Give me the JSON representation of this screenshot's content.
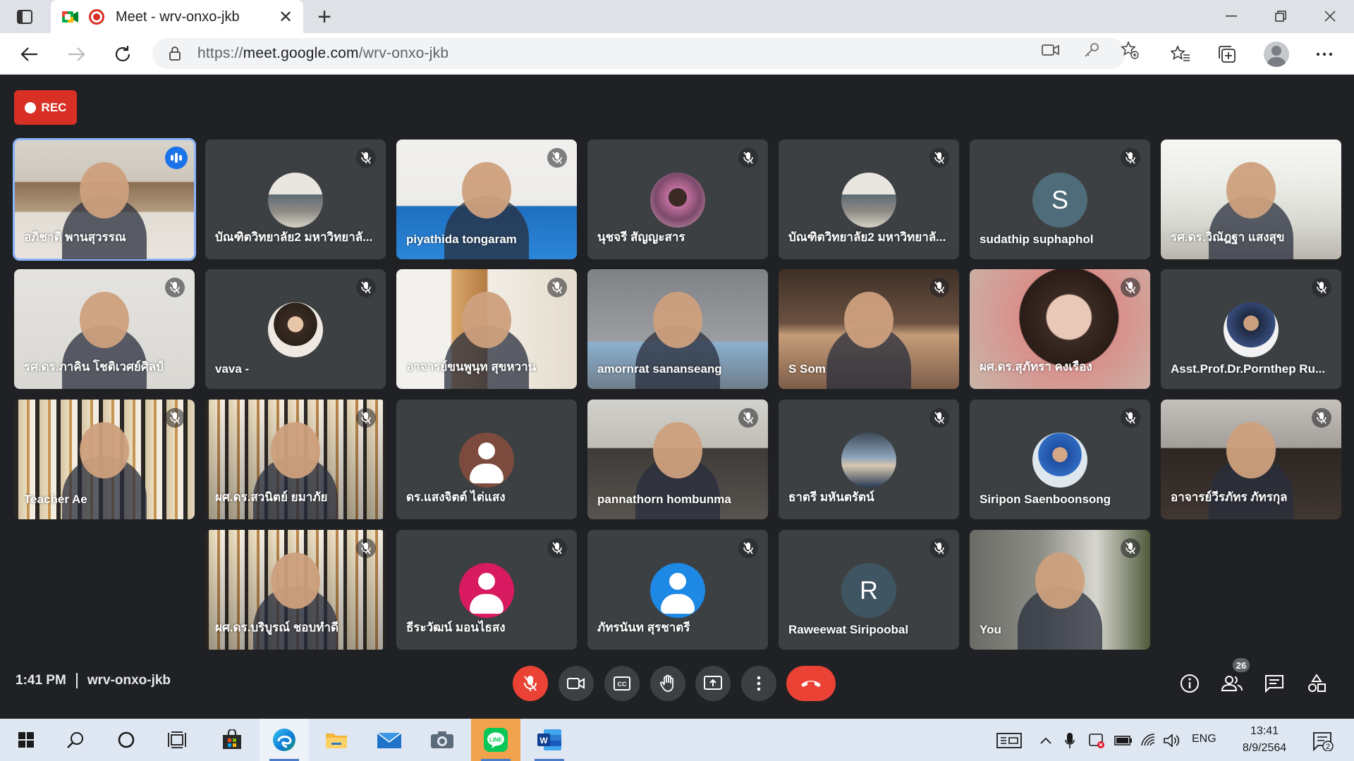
{
  "browser": {
    "tab_title": "Meet - wrv-onxo-jkb",
    "url_prefix": "https://",
    "url_host": "meet.google.com",
    "url_path": "/wrv-onxo-jkb"
  },
  "meet": {
    "rec_label": "REC",
    "time": "1:41 PM",
    "meeting_code": "wrv-onxo-jkb",
    "participant_count": "26",
    "participants": [
      {
        "name": "อภิชาติ พานสุวรรณ",
        "state": "speaking"
      },
      {
        "name": "บัณฑิตวิทยาลัย2 มหาวิทยาลั...",
        "state": "muted"
      },
      {
        "name": "piyathida tongaram",
        "state": "muted"
      },
      {
        "name": "นุชจรี สัญญะสาร",
        "state": "muted"
      },
      {
        "name": "บัณฑิตวิทยาลัย2 มหาวิทยาลั...",
        "state": "muted"
      },
      {
        "name": "sudathip suphaphol",
        "state": "muted",
        "avatar_letter": "S"
      },
      {
        "name": "รศ.ดร.วิณัฎฐา แสงสุข",
        "state": "video"
      },
      {
        "name": "รศ.ดร.ภาคิน โชติเวศย์ศิลป์",
        "state": "muted"
      },
      {
        "name": "vava -",
        "state": "muted"
      },
      {
        "name": "อาจารย์ขนพูนุท สุขหวาน",
        "state": "muted"
      },
      {
        "name": "amornrat sananseang",
        "state": "video"
      },
      {
        "name": "S Som",
        "state": "muted"
      },
      {
        "name": "ผศ.ดร.สุภัทรา คงเรือง",
        "state": "muted"
      },
      {
        "name": "Asst.Prof.Dr.Pornthep Ru...",
        "state": "muted"
      },
      {
        "name": "Teacher Ae",
        "state": "muted"
      },
      {
        "name": "ผศ.ดร.สวนิตย์ ยมาภัย",
        "state": "muted"
      },
      {
        "name": "ดร.แสงจิตต์ ไต่แสง",
        "state": "video"
      },
      {
        "name": "pannathorn hombunma",
        "state": "muted"
      },
      {
        "name": "ธาตรี มหันตรัตน์",
        "state": "muted"
      },
      {
        "name": "Siripon Saenboonsong",
        "state": "muted"
      },
      {
        "name": "อาจารย์วีรภัทร ภัทรกุล",
        "state": "muted"
      },
      {
        "name": "ผศ.ดร.บริบูรณ์ ชอบทำดี",
        "state": "muted"
      },
      {
        "name": "ธีระวัฒน์ มอนไธสง",
        "state": "muted"
      },
      {
        "name": "ภัทรนันท สุรชาตรี",
        "state": "muted"
      },
      {
        "name": "Raweewat Siripoobal",
        "state": "muted",
        "avatar_letter": "R"
      },
      {
        "name": "You",
        "state": "muted"
      }
    ]
  },
  "taskbar": {
    "lang": "ENG",
    "clock_time": "13:41",
    "clock_date": "8/9/2564",
    "notif_count": "2"
  },
  "colors": {
    "meet_bg": "#202124",
    "tile_bg": "#3c4043",
    "accent_red": "#ea4335",
    "speaking_blue": "#1a73e8"
  }
}
